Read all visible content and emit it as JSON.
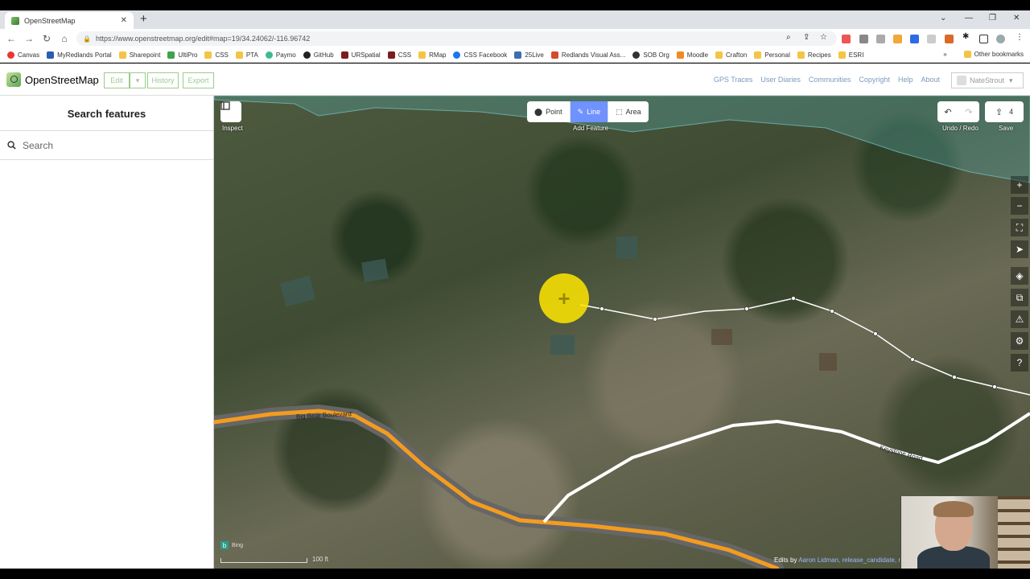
{
  "browser": {
    "tab_title": "OpenStreetMap",
    "url": "https://www.openstreetmap.org/edit#map=19/34.24062/-116.96742",
    "bookmarks": [
      "Canvas",
      "MyRedlands Portal",
      "Sharepoint",
      "UltiPro",
      "CSS",
      "PTA",
      "Paymo",
      "GitHub",
      "URSpatial",
      "CSS",
      "RMap",
      "CSS Facebook",
      "25Live",
      "Redlands Visual Ass...",
      "SOB Org",
      "Moodle",
      "Crafton",
      "Personal",
      "Recipes",
      "ESRI"
    ],
    "other_bookmarks": "Other bookmarks",
    "overflow": "»"
  },
  "osm": {
    "brand": "OpenStreetMap",
    "edit": "Edit",
    "history": "History",
    "export": "Export",
    "nav": [
      "GPS Traces",
      "User Diaries",
      "Communities",
      "Copyright",
      "Help",
      "About"
    ],
    "user": "NateStrout"
  },
  "sidebar": {
    "title": "Search features",
    "search_placeholder": "Search"
  },
  "map": {
    "inspect": "Inspect",
    "modes": {
      "point": "Point",
      "line": "Line",
      "area": "Area",
      "label": "Add Feature"
    },
    "undo_redo_label": "Undo / Redo",
    "save_label": "Save",
    "save_count": "4",
    "road1": "Big Bear Boulevard",
    "road2": "Keystone Road",
    "bing": "Bing",
    "scale": "100 ft",
    "attrib_prefix": "Edits by",
    "attrib_link": "Aaron Lidman, release_candidate, n"
  }
}
